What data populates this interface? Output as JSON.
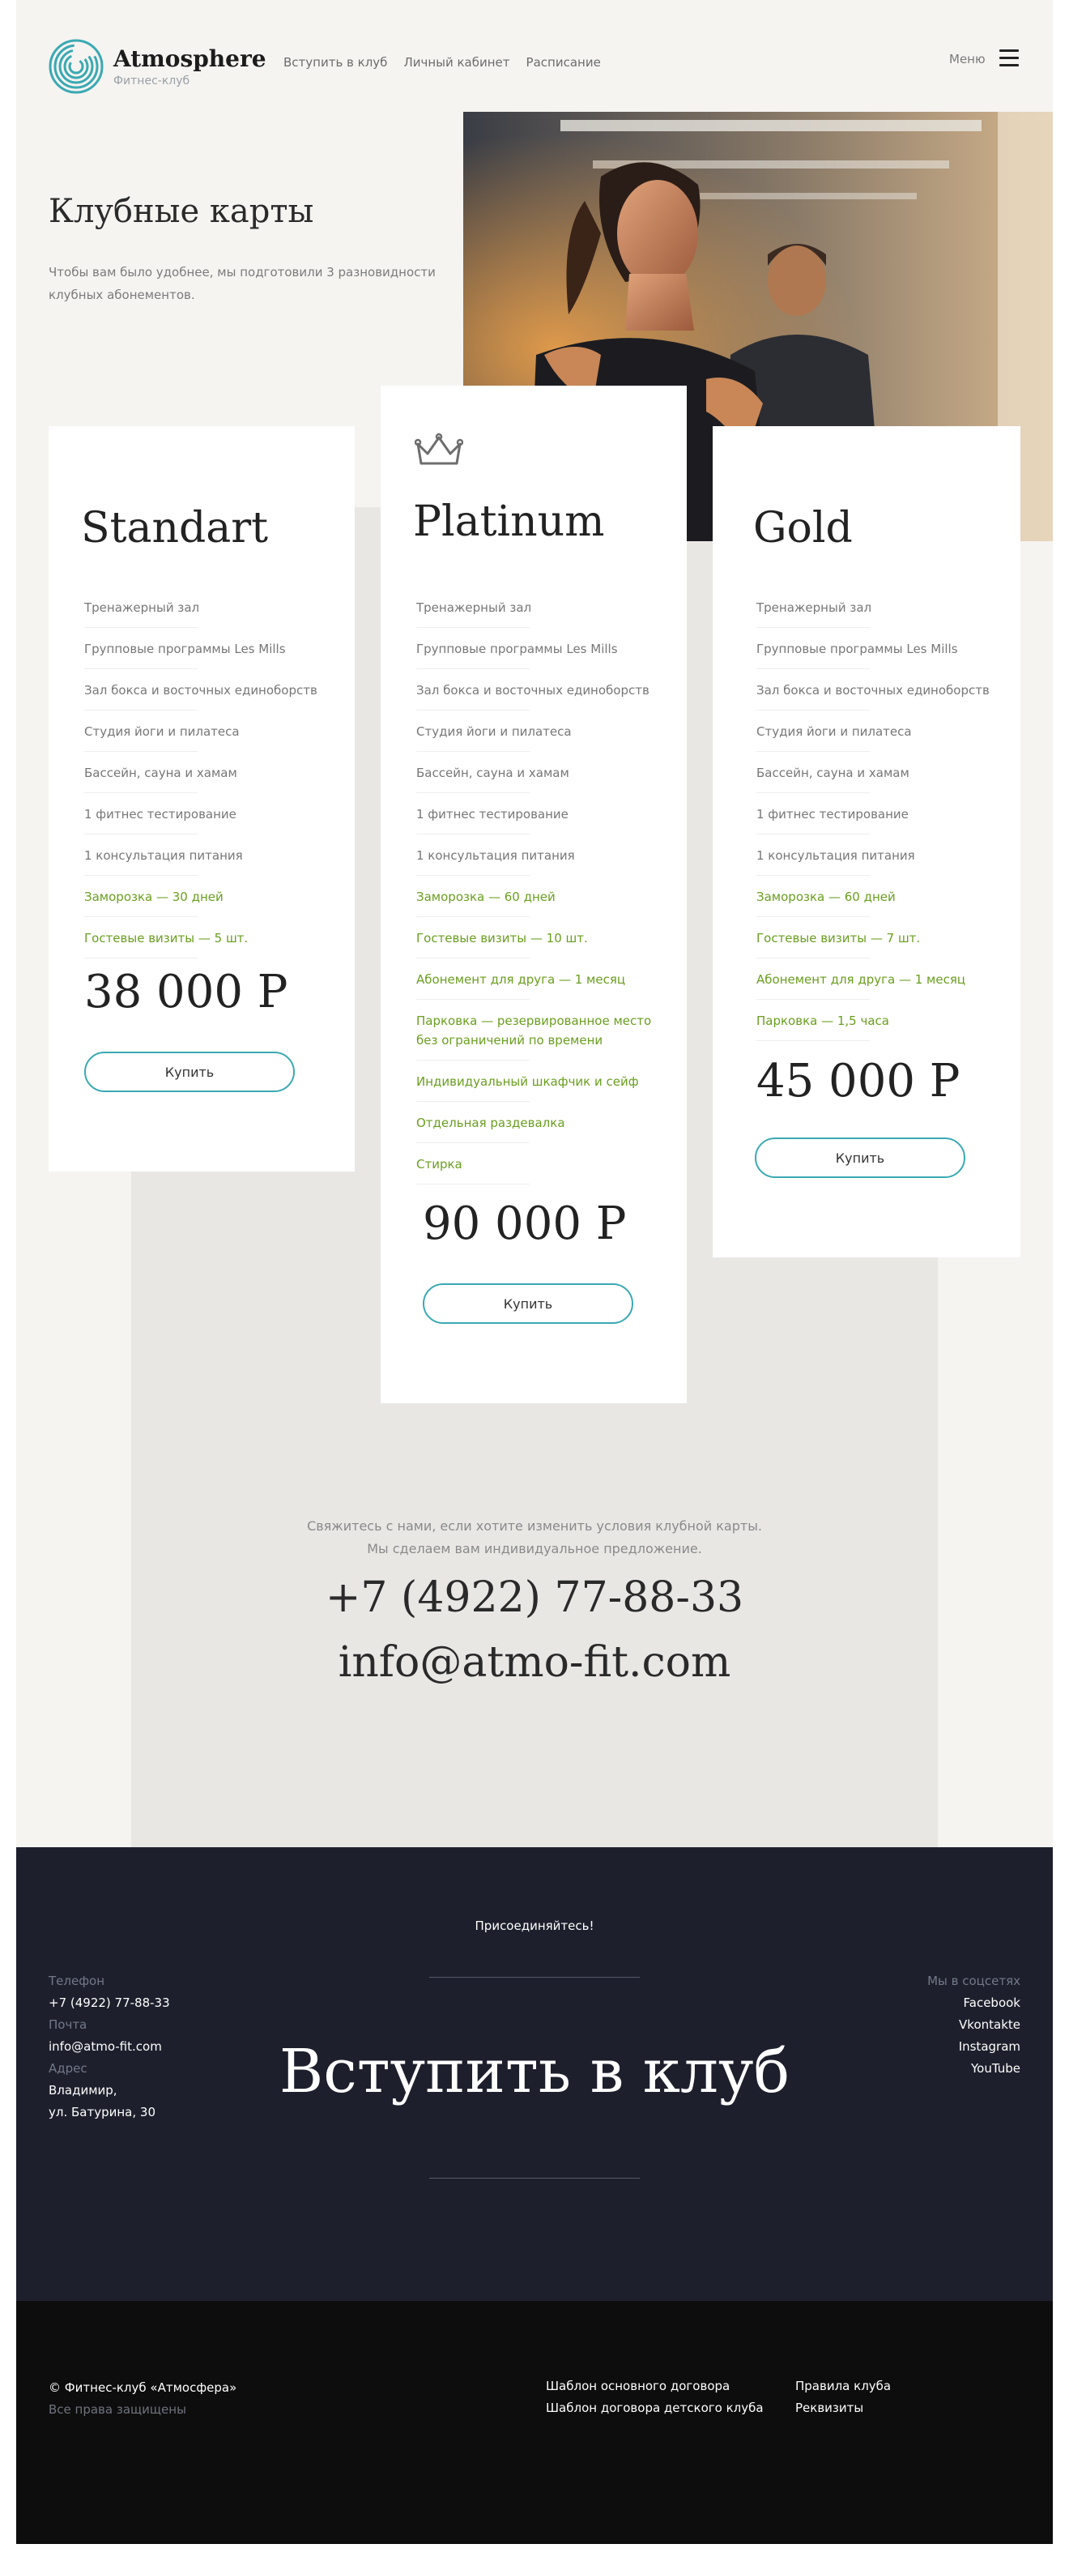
{
  "header": {
    "brand": "Atmosphere",
    "brand_sub": "Фитнес-клуб",
    "nav": [
      "Вступить в клуб",
      "Личный кабинет",
      "Расписание"
    ],
    "menu_label": "Меню"
  },
  "hero": {
    "title": "Клубные карты",
    "description": "Чтобы вам было удобнее, мы подготовили 3 разновидности клубных абонементов."
  },
  "cards": [
    {
      "name": "Standart",
      "features": [
        "Тренажерный зал",
        "Групповые программы Les Mills",
        "Зал бокса и восточных единоборств",
        "Студия йоги и пилатеса",
        "Бассейн, сауна и хамам",
        "1 фитнес тестирование",
        "1 консультация питания"
      ],
      "extras": [
        "Заморозка — 30 дней",
        "Гостевые визиты — 5 шт."
      ],
      "price": "38 000 Р",
      "button": "Купить"
    },
    {
      "name": "Platinum",
      "icon": "crown-icon",
      "features": [
        "Тренажерный зал",
        "Групповые программы Les Mills",
        "Зал бокса и восточных единоборств",
        "Студия йоги и пилатеса",
        "Бассейн, сауна и хамам",
        "1 фитнес тестирование",
        "1 консультация питания"
      ],
      "extras": [
        "Заморозка — 60 дней",
        "Гостевые визиты — 10 шт.",
        "Абонемент для друга — 1 месяц",
        "Парковка — резервированное место без ограничений по времени",
        "Индивидуальный шкафчик и сейф",
        "Отдельная раздевалка",
        "Стирка"
      ],
      "price": "90 000 Р",
      "button": "Купить"
    },
    {
      "name": "Gold",
      "features": [
        "Тренажерный зал",
        "Групповые программы Les Mills",
        "Зал бокса и восточных единоборств",
        "Студия йоги и пилатеса",
        "Бассейн, сауна и хамам",
        "1 фитнес тестирование",
        "1 консультация питания"
      ],
      "extras": [
        "Заморозка — 60 дней",
        "Гостевые визиты — 7 шт.",
        "Абонемент для друга — 1 месяц",
        "Парковка — 1,5 часа"
      ],
      "price": "45 000 Р",
      "button": "Купить"
    }
  ],
  "contact": {
    "note_line1": "Свяжитесь с нами, если хотите изменить условия клубной карты.",
    "note_line2": "Мы сделаем вам индивидуальное предложение.",
    "phone": "+7 (4922) 77-88-33",
    "email": "info@atmo-fit.com"
  },
  "join": {
    "pre": "Присоединяйтесь!",
    "title": "Вступить в клуб",
    "phone_label": "Телефон",
    "phone": "+7 (4922) 77-88-33",
    "email_label": "Почта",
    "email": "info@atmo-fit.com",
    "address_label": "Адрес",
    "address_line1": "Владимир,",
    "address_line2": "ул. Батурина, 30",
    "social_label": "Мы в соцсетях",
    "socials": [
      "Facebook",
      "Vkontakte",
      "Instagram",
      "YouTube"
    ]
  },
  "footer": {
    "copyright": "© Фитнес-клуб «Атмосфера»",
    "rights": "Все права защищены",
    "links_a": [
      "Шаблон основного договора",
      "Шаблон договора детского клуба"
    ],
    "links_b": [
      "Правила клуба",
      "Реквизиты"
    ]
  },
  "colors": {
    "accent": "#3aa9b3",
    "extra_text": "#6a9e1f",
    "dark_bg": "#1d202c",
    "footer_bg": "#0d0d0e",
    "page_bg": "#f5f4f1"
  }
}
